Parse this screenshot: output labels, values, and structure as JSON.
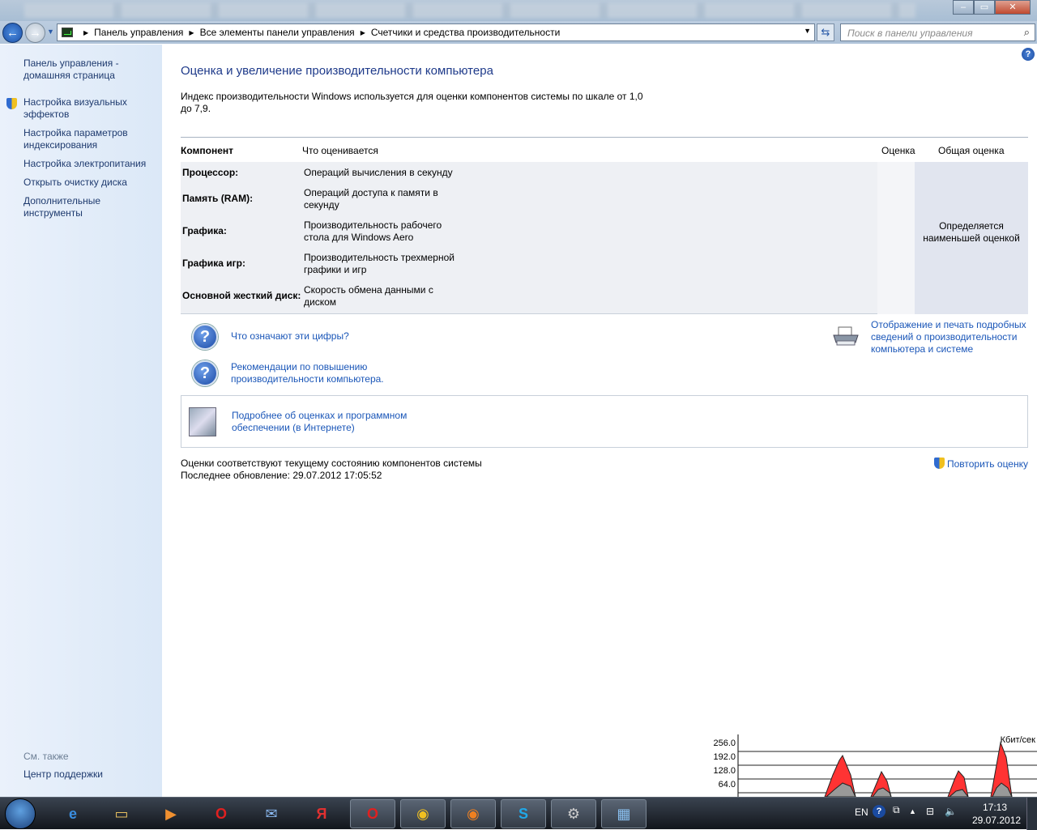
{
  "window": {
    "minimize": "‒",
    "maximize": "▭",
    "close": "✕"
  },
  "nav": {
    "back": "←",
    "forward": "→",
    "crumbs": [
      "Панель управления",
      "Все элементы панели управления",
      "Счетчики и средства производительности"
    ],
    "search_placeholder": "Поиск в панели управления"
  },
  "sidebar": {
    "items": [
      "Панель управления - домашняя страница",
      "Настройка визуальных эффектов",
      "Настройка параметров индексирования",
      "Настройка электропитания",
      "Открыть очистку диска",
      "Дополнительные инструменты"
    ],
    "see_also": "См. также",
    "support": "Центр поддержки"
  },
  "main": {
    "title": "Оценка и увеличение производительности компьютера",
    "intro": "Индекс производительности Windows используется для оценки компонентов системы по шкале от 1,0 до 7,9.",
    "headers": {
      "component": "Компонент",
      "what": "Что оценивается",
      "score": "Оценка",
      "overall": "Общая оценка"
    },
    "rows": [
      {
        "component": "Процессор:",
        "what": "Операций вычисления в секунду"
      },
      {
        "component": "Память (RAM):",
        "what": "Операций доступа к памяти в секунду"
      },
      {
        "component": "Графика:",
        "what": "Производительность рабочего стола для Windows Aero"
      },
      {
        "component": "Графика игр:",
        "what": "Производительность трехмерной графики и игр"
      },
      {
        "component": "Основной жесткий диск:",
        "what": "Скорость обмена данными с диском"
      }
    ],
    "overall_text": "Определяется наименьшей оценкой",
    "link_meaning": "Что означают эти цифры?",
    "link_tips": "Рекомендации по повышению производительности компьютера.",
    "link_print": "Отображение и печать подробных сведений о производительности компьютера и системе",
    "link_more": "Подробнее об оценках и программном обеспечении (в Интернете)",
    "status": "Оценки соответствуют текущему состоянию компонентов системы",
    "last_update": "Последнее обновление: 29.07.2012 17:05:52",
    "rerun": "Повторить оценку"
  },
  "net_widget": {
    "unit": "Кбит/сек",
    "ticks": [
      "256.0",
      "192.0",
      "128.0",
      "64.0"
    ]
  },
  "taskbar": {
    "lang": "EN",
    "time": "17:13",
    "date": "29.07.2012",
    "apps": [
      "internet-explorer",
      "explorer",
      "media-player",
      "opera",
      "mail",
      "yandex",
      "opera-red",
      "chrome",
      "firefox",
      "skype",
      "steam",
      "performance"
    ]
  }
}
